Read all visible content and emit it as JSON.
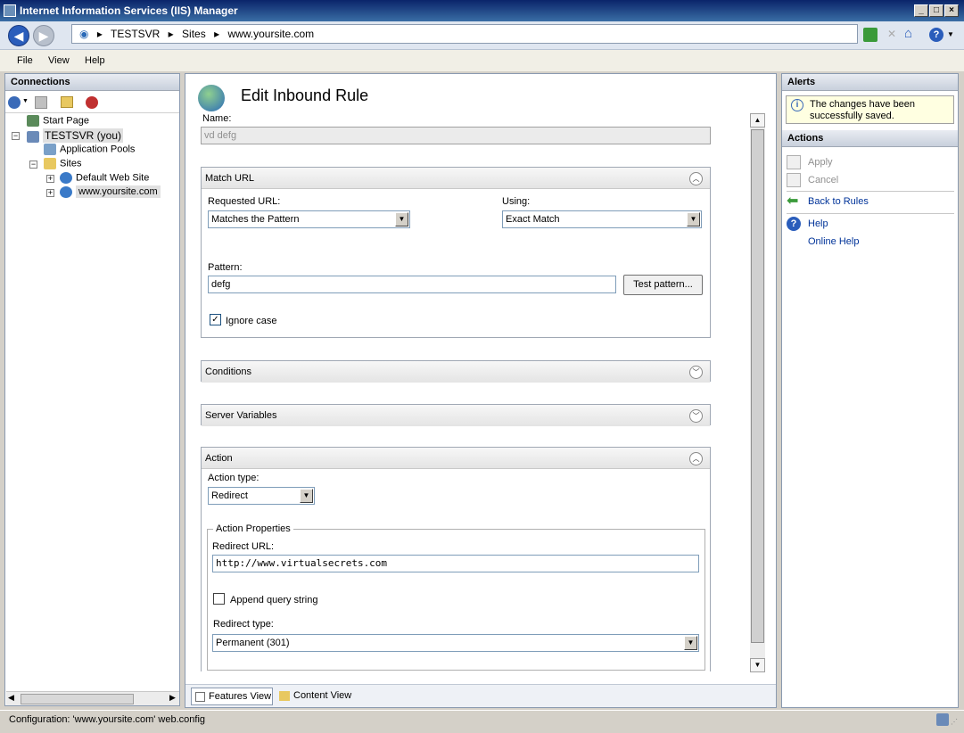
{
  "window": {
    "title": "Internet Information Services (IIS) Manager"
  },
  "address": {
    "crumbs": [
      "TESTSVR",
      "Sites",
      "www.yoursite.com"
    ]
  },
  "menu": [
    "File",
    "View",
    "Help"
  ],
  "connections": {
    "title": "Connections",
    "tree": [
      "Start Page",
      "TESTSVR (you)",
      "Application Pools",
      "Sites",
      "Default Web Site",
      "www.yoursite.com"
    ]
  },
  "page": {
    "title": "Edit Inbound Rule",
    "name_label": "Name:",
    "name_value": "vd defg"
  },
  "match": {
    "title": "Match URL",
    "requested_label": "Requested URL:",
    "requested_value": "Matches the Pattern",
    "using_label": "Using:",
    "using_value": "Exact Match",
    "pattern_label": "Pattern:",
    "pattern_value": "defg",
    "test_button": "Test pattern...",
    "ignore_case": "Ignore case",
    "ignore_case_checked": true
  },
  "conditions": {
    "title": "Conditions"
  },
  "server_vars": {
    "title": "Server Variables"
  },
  "action": {
    "title": "Action",
    "type_label": "Action type:",
    "type_value": "Redirect",
    "props_title": "Action Properties",
    "redirect_url_label": "Redirect URL:",
    "redirect_url_value": "http://www.virtualsecrets.com",
    "append_qs": "Append query string",
    "append_qs_checked": false,
    "redirect_type_label": "Redirect type:",
    "redirect_type_value": "Permanent (301)"
  },
  "bottom_tabs": [
    "Features View",
    "Content View"
  ],
  "alerts": {
    "title": "Alerts",
    "message": "The changes have been successfully saved."
  },
  "actions": {
    "title": "Actions",
    "items": [
      "Apply",
      "Cancel",
      "Back to Rules",
      "Help",
      "Online Help"
    ]
  },
  "status": {
    "text": "Configuration: 'www.yoursite.com' web.config"
  },
  "colors": {
    "title_bar": "#0a246a",
    "panel_bg": "#ffffff",
    "alert_bg": "#ffffe1",
    "link": "#003399"
  }
}
